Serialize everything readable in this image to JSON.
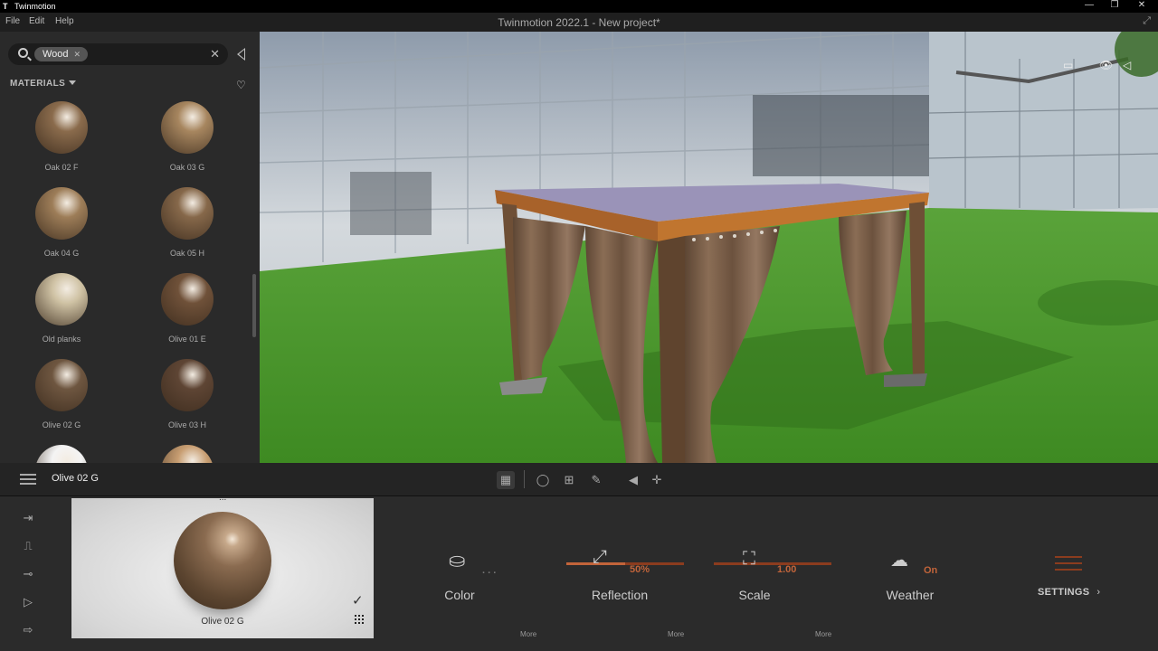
{
  "window": {
    "app_name": "Twinmotion",
    "title": "Twinmotion 2022.1 - New project*",
    "menu": [
      "File",
      "Edit",
      "Help"
    ],
    "controls": [
      "—",
      "❐",
      "✕"
    ]
  },
  "library": {
    "search_chip": "Wood",
    "section_title": "MATERIALS",
    "materials": [
      {
        "name": "Oak 02 F",
        "color": "#8a6b4c"
      },
      {
        "name": "Oak 03 G",
        "color": "#a7865f"
      },
      {
        "name": "Oak 04 G",
        "color": "#9d7d58"
      },
      {
        "name": "Oak 05 H",
        "color": "#86684a"
      },
      {
        "name": "Old planks",
        "color": "#cfc2a4"
      },
      {
        "name": "Olive 01 E",
        "color": "#6f5139"
      },
      {
        "name": "Olive 02 G",
        "color": "#6e5640"
      },
      {
        "name": "Olive 03 H",
        "color": "#5e4534"
      },
      {
        "name": "",
        "color": "#f4f4f4"
      },
      {
        "name": "",
        "color": "#c89e72"
      }
    ]
  },
  "toolbar": {
    "selected_material": "Olive 02 G"
  },
  "editor": {
    "preview_name": "Olive 02 G",
    "preview_menu": "...",
    "params": {
      "color": {
        "label": "Color",
        "value": ". . ."
      },
      "reflection": {
        "label": "Reflection",
        "value": "50%",
        "fraction": 0.5
      },
      "scale": {
        "label": "Scale",
        "value": "1.00"
      },
      "weather": {
        "label": "Weather",
        "value": "On"
      }
    },
    "more_label": "More",
    "settings_label": "SETTINGS"
  },
  "colors": {
    "accent": "#c2643a",
    "accent_dark": "#8b3c1e",
    "panel": "#2a2a2a",
    "grass": "#4f8f2a"
  }
}
